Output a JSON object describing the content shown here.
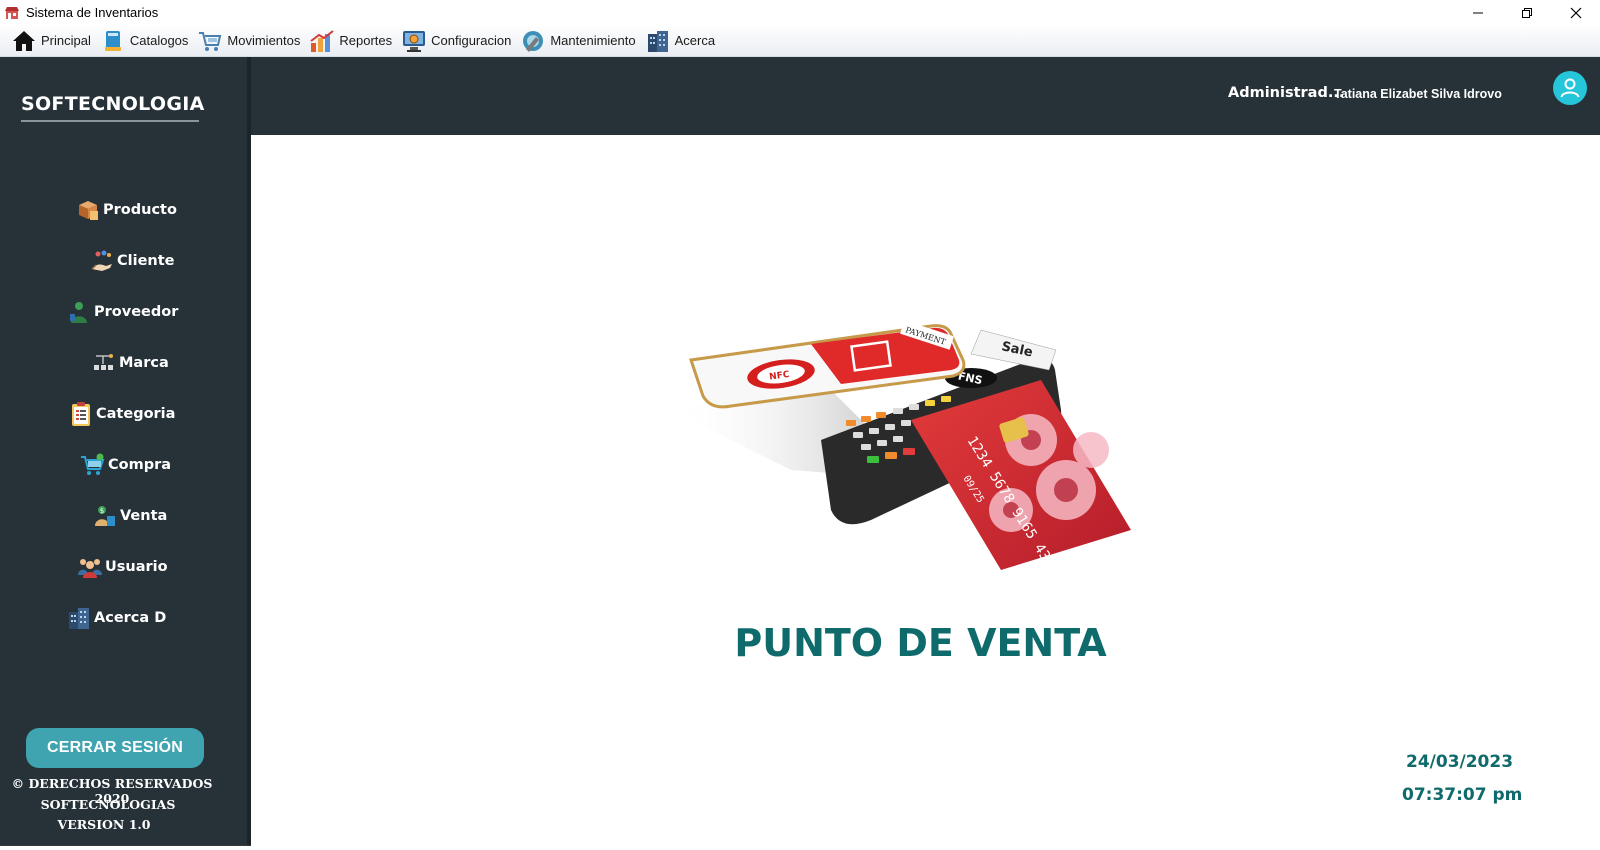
{
  "window": {
    "title": "Sistema de Inventarios"
  },
  "menu": {
    "items": [
      {
        "label": "Principal",
        "icon": "home-icon"
      },
      {
        "label": "Catalogos",
        "icon": "catalog-icon"
      },
      {
        "label": "Movimientos",
        "icon": "cart-icon"
      },
      {
        "label": "Reportes",
        "icon": "report-chart-icon"
      },
      {
        "label": "Configuracion",
        "icon": "settings-monitor-icon"
      },
      {
        "label": "Mantenimiento",
        "icon": "maintenance-icon"
      },
      {
        "label": "Acerca",
        "icon": "building-icon"
      }
    ]
  },
  "sidebar": {
    "brand": "SOFTECNOLOGIA",
    "items": [
      {
        "label": "Producto",
        "icon": "product-box-icon"
      },
      {
        "label": "Cliente",
        "icon": "client-icon"
      },
      {
        "label": "Proveedor",
        "icon": "supplier-icon"
      },
      {
        "label": "Marca",
        "icon": "brand-icon"
      },
      {
        "label": "Categoria",
        "icon": "category-icon"
      },
      {
        "label": "Compra",
        "icon": "purchase-cart-icon"
      },
      {
        "label": "Venta",
        "icon": "sale-icon"
      },
      {
        "label": "Usuario",
        "icon": "users-icon"
      },
      {
        "label": "Acerca D",
        "icon": "building-icon"
      }
    ],
    "logout_label": "CERRAR SESIÓN",
    "footer": {
      "rights": "© DERECHOS RESERVADOS 2020",
      "company": "SOFTECNOLOGIAS",
      "version": "VERSION 1.0"
    }
  },
  "header": {
    "role": "Administrad...",
    "user": "Tatiana Elizabet Silva Idrovo"
  },
  "main": {
    "title": "PUNTO DE VENTA",
    "date": "24/03/2023",
    "time": "07:37:07 pm",
    "hero_image": {
      "phone_badge": "NFC",
      "phone_banner": "PAYMENT",
      "receipt_text": "Sale",
      "terminal_brand": "FNS",
      "card_number": "1234 5678 9165 4321",
      "card_expiry": "09/25"
    }
  },
  "colors": {
    "sidebar_bg": "#263238",
    "accent_teal": "#0f6b6b",
    "logout_bg": "#3fa4b0",
    "avatar_bg": "#26c6da"
  }
}
